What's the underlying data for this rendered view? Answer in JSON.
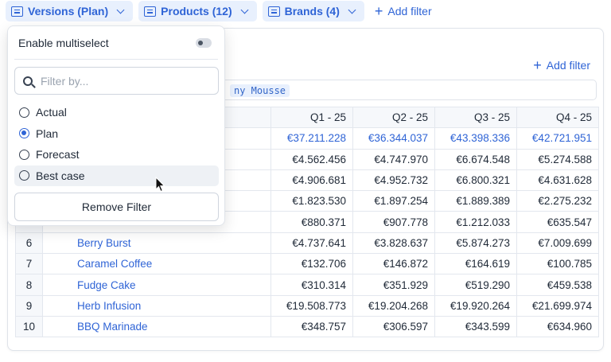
{
  "filters": {
    "chips": [
      {
        "label": "Versions (Plan)"
      },
      {
        "label": "Products (12)"
      },
      {
        "label": "Brands (4)"
      }
    ],
    "add_filter_label": "Add filter"
  },
  "card": {
    "add_filter_label": "Add filter",
    "chip_text": "ny Mousse"
  },
  "table": {
    "columns": [
      "Q1 - 25",
      "Q2 - 25",
      "Q3 - 25",
      "Q4 - 25"
    ],
    "total_row": [
      "€37.211.228",
      "€36.344.037",
      "€43.398.336",
      "€42.721.951"
    ],
    "rows": [
      {
        "idx": "",
        "name": "",
        "values": [
          "€4.562.456",
          "€4.747.970",
          "€6.674.548",
          "€5.274.588"
        ]
      },
      {
        "idx": "",
        "name": "",
        "values": [
          "€4.906.681",
          "€4.952.732",
          "€6.800.321",
          "€4.631.628"
        ]
      },
      {
        "idx": "",
        "name": "",
        "values": [
          "€1.823.530",
          "€1.897.254",
          "€1.889.389",
          "€2.275.232"
        ]
      },
      {
        "idx": "",
        "name": "",
        "values": [
          "€880.371",
          "€907.778",
          "€1.212.033",
          "€635.547"
        ]
      },
      {
        "idx": "6",
        "name": "Berry Burst",
        "values": [
          "€4.737.641",
          "€3.828.637",
          "€5.874.273",
          "€7.009.699"
        ]
      },
      {
        "idx": "7",
        "name": "Caramel Coffee",
        "values": [
          "€132.706",
          "€146.872",
          "€164.619",
          "€100.785"
        ]
      },
      {
        "idx": "8",
        "name": "Fudge Cake",
        "values": [
          "€310.314",
          "€351.929",
          "€519.290",
          "€459.538"
        ]
      },
      {
        "idx": "9",
        "name": "Herb Infusion",
        "values": [
          "€19.508.773",
          "€19.204.268",
          "€19.920.264",
          "€21.699.974"
        ]
      },
      {
        "idx": "10",
        "name": "BBQ Marinade",
        "values": [
          "€348.757",
          "€306.597",
          "€343.599",
          "€634.960"
        ]
      }
    ]
  },
  "popover": {
    "multiselect_label": "Enable multiselect",
    "multiselect_enabled": false,
    "search_placeholder": "Filter by...",
    "options": [
      {
        "label": "Actual",
        "selected": false
      },
      {
        "label": "Plan",
        "selected": true
      },
      {
        "label": "Forecast",
        "selected": false
      },
      {
        "label": "Best case",
        "selected": false,
        "hovered": true
      }
    ],
    "remove_label": "Remove Filter"
  },
  "colors": {
    "accent": "#2f64d6",
    "chip_bg": "#e8f0fd"
  }
}
